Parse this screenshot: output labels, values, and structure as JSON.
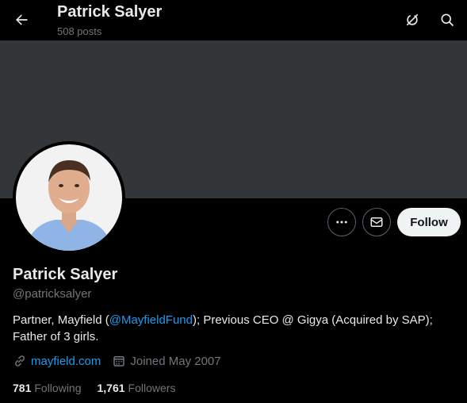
{
  "header": {
    "title": "Patrick Salyer",
    "posts": "508 posts"
  },
  "actions": {
    "follow_label": "Follow"
  },
  "profile": {
    "name": "Patrick Salyer",
    "handle": "@patricksalyer",
    "bio_before": "Partner, Mayfield (",
    "bio_mention": "@MayfieldFund",
    "bio_after": "); Previous CEO @ Gigya (Acquired by SAP); Father of 3 girls.",
    "website": "mayfield.com",
    "joined": "Joined May 2007",
    "following_count": "781",
    "following_label": "Following",
    "followers_count": "1,761",
    "followers_label": "Followers"
  },
  "colors": {
    "background": "#000000",
    "banner": "#333639",
    "link": "#1d9bf0",
    "muted": "#71767b",
    "follow_button": "#eff3f4"
  },
  "icons": [
    "back-arrow-icon",
    "refresh-icon",
    "search-icon",
    "more-icon",
    "mail-icon",
    "link-icon",
    "calendar-icon"
  ]
}
